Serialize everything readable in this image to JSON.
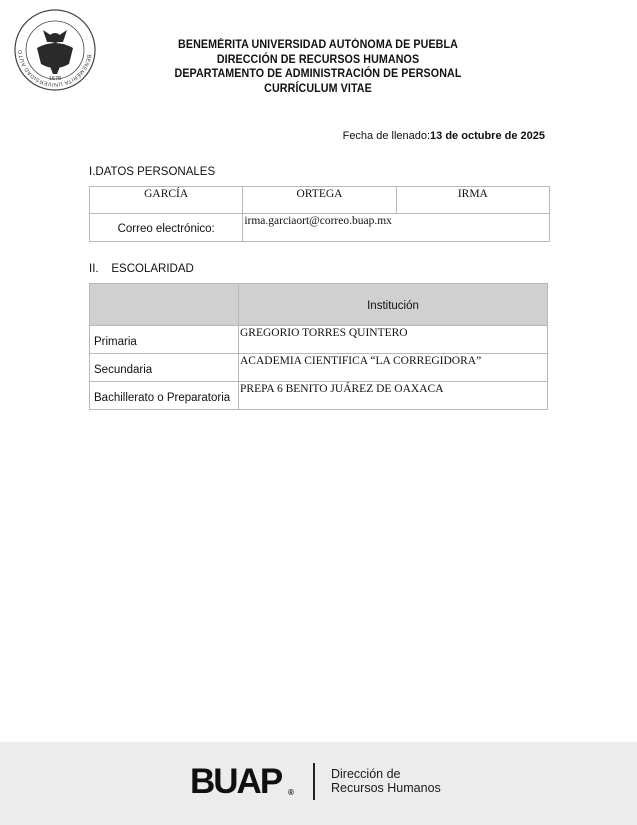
{
  "header": {
    "line1": "BENEMÉRITA UNIVERSIDAD AUTÓNOMA DE PUEBLA",
    "line2": "DIRECCIÓN DE RECURSOS HUMANOS",
    "line3": "DEPARTAMENTO DE ADMINISTRACIÓN DE PERSONAL",
    "line4": "CURRÍCULUM VITAE"
  },
  "seal": {
    "text": "BENEMÉRITA UNIVERSIDAD AUTÓNOMA DE PUEBLA",
    "year": "1578"
  },
  "fecha": {
    "label": "Fecha de llenado:",
    "value": "13 de octubre de 2025"
  },
  "datos_personales": {
    "title": "I.DATOS PERSONALES",
    "apellido_paterno": "GARCÍA",
    "apellido_materno": "ORTEGA",
    "nombre": "IRMA",
    "correo_label": "Correo electrónico:",
    "correo_value": "irma.garciaort@correo.buap.mx"
  },
  "escolaridad": {
    "title": "II.    ESCOLARIDAD",
    "column_header": "Institución",
    "rows": [
      {
        "level": "Primaria",
        "institution": "GREGORIO TORRES QUINTERO"
      },
      {
        "level": "Secundaria",
        "institution": "ACADEMIA CIENTIFICA “LA CORREGIDORA”"
      },
      {
        "level": "Bachillerato o Preparatoria",
        "institution": "PREPA 6 BENITO JUÁREZ DE OAXACA"
      }
    ]
  },
  "footer": {
    "logo": "BUAP",
    "registered": "®",
    "dept_line1": "Dirección de",
    "dept_line2": "Recursos Humanos"
  }
}
